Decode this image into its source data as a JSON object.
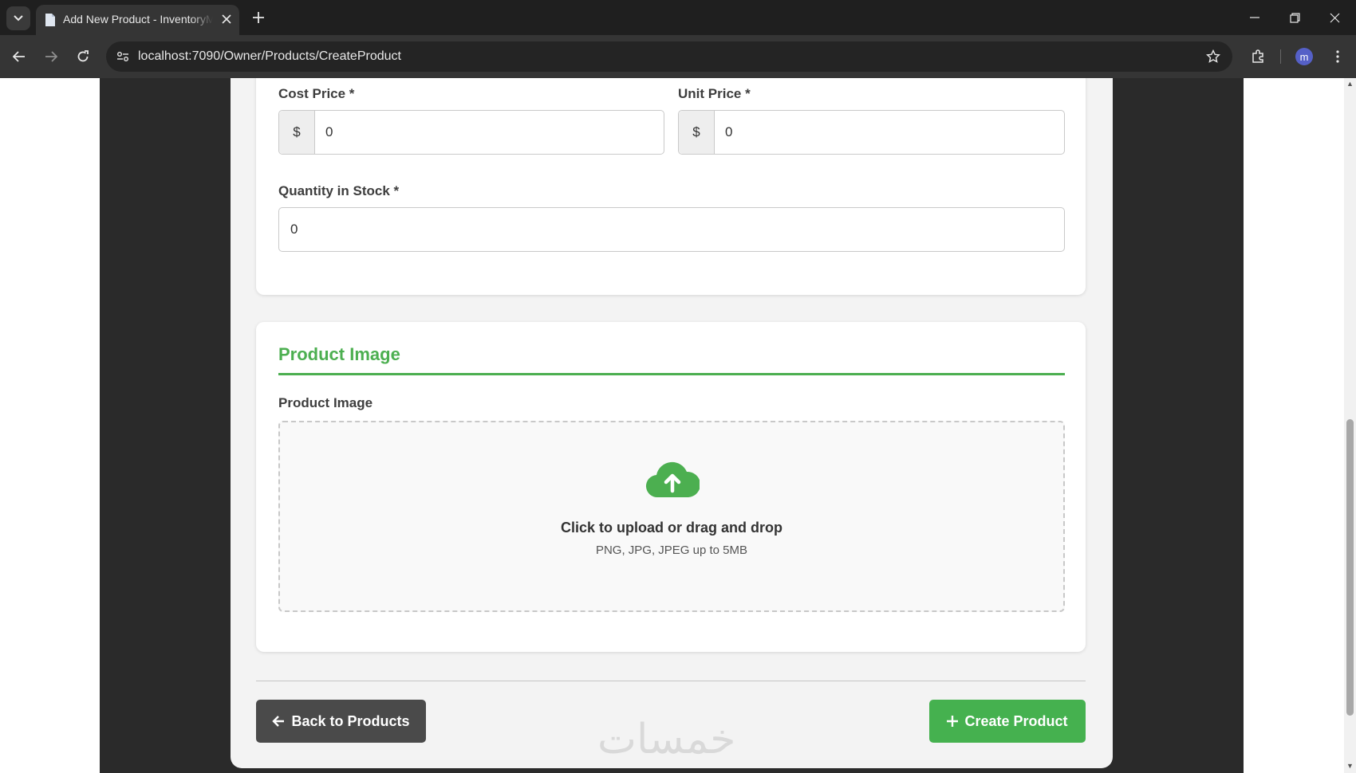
{
  "browser": {
    "tab_title": "Add New Product - InventoryMgmt",
    "url": "localhost:7090/Owner/Products/CreateProduct",
    "avatar_initial": "m"
  },
  "pricing": {
    "cost_price_label": "Cost Price *",
    "cost_price_symbol": "$",
    "cost_price_value": "0",
    "unit_price_label": "Unit Price *",
    "unit_price_symbol": "$",
    "unit_price_value": "0",
    "quantity_label": "Quantity in Stock *",
    "quantity_value": "0"
  },
  "image_section": {
    "title": "Product Image",
    "field_label": "Product Image",
    "upload_text": "Click to upload or drag and drop",
    "upload_hint": "PNG, JPG, JPEG up to 5MB"
  },
  "actions": {
    "back_label": "Back to Products",
    "create_label": "Create Product"
  },
  "watermark": "خمسات",
  "colors": {
    "accent": "#4caf50",
    "create_button": "#45b14f",
    "back_button": "#4a4a4a"
  }
}
